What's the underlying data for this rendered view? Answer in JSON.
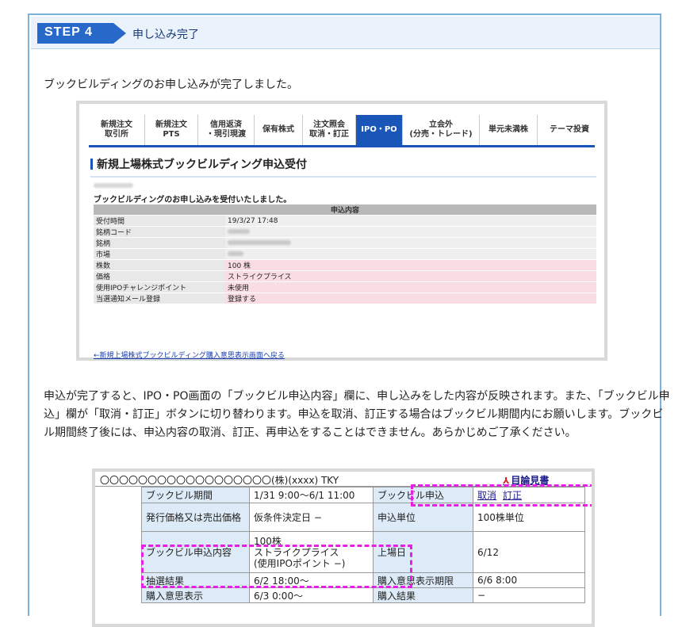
{
  "step": {
    "badge": "STEP 4",
    "title": "申し込み完了"
  },
  "intro": "ブックビルディングのお申し込みが完了しました。",
  "screenshot1": {
    "tabs": [
      {
        "l1": "新規注文",
        "l2": "取引所"
      },
      {
        "l1": "新規注文",
        "l2": "PTS"
      },
      {
        "l1": "信用返済",
        "l2": "・現引現渡"
      },
      {
        "l1": "保有株式",
        "l2": ""
      },
      {
        "l1": "注文照会",
        "l2": "取消・訂正"
      },
      {
        "l1": "IPO・PO",
        "l2": ""
      },
      {
        "l1": "立会外",
        "l2": "(分売・トレード)"
      },
      {
        "l1": "単元未満株",
        "l2": ""
      },
      {
        "l1": "テーマ投資",
        "l2": ""
      }
    ],
    "title": "新規上場株式ブックビルディング申込受付",
    "message": "ブックビルディングのお申し込みを受付いたしました。",
    "table_header": "申込内容",
    "rows": [
      {
        "label": "受付時間",
        "value": "19/3/27 17:48"
      },
      {
        "label": "銘柄コード",
        "value": ""
      },
      {
        "label": "銘柄",
        "value": ""
      },
      {
        "label": "市場",
        "value": ""
      },
      {
        "label": "株数",
        "value": "100 株"
      },
      {
        "label": "価格",
        "value": "ストライクプライス"
      },
      {
        "label": "使用IPOチャレンジポイント",
        "value": "未使用"
      },
      {
        "label": "当選通知メール登録",
        "value": "登録する"
      }
    ],
    "back_link": "←新規上場株式ブックビルディング購入意思表示画面へ戻る"
  },
  "paragraph": "申込が完了すると、IPO・PO画面の「ブックビル申込内容」欄に、申し込みをした内容が反映されます。また、「ブックビル申込」欄が「取消・訂正」ボタンに切り替わります。申込を取消、訂正する場合はブックビル期間内にお願いします。ブックビル期間終了後には、申込内容の取消、訂正、再申込をすることはできません。あらかじめご了承ください。",
  "screenshot2": {
    "company": "〇〇〇〇〇〇〇〇〇〇〇〇〇〇〇〇〇〇(株)(xxxx) TKY",
    "prospectus": "目論見書",
    "bookbuild_period_label": "ブックビル期間",
    "bookbuild_period_value": "1/31 9:00〜6/1 11:00",
    "bookbuild_apply_label": "ブックビル申込",
    "cancel": "取消",
    "correct": "訂正",
    "price_label": "発行価格又は売出価格",
    "price_value": "仮条件決定日 −",
    "unit_label": "申込単位",
    "unit_value": "100株単位",
    "content_label": "ブックビル申込内容",
    "content_l1": "100株",
    "content_l2": "ストライクプライス",
    "content_l3": "(使用IPOポイント −)",
    "listing_label": "上場日",
    "listing_value": "6/12",
    "lottery_label": "抽選結果",
    "lottery_value": "6/2 18:00〜",
    "deadline_label": "購入意思表示期限",
    "deadline_value": "6/6 8:00",
    "intent_label": "購入意思表示",
    "intent_value": "6/3 0:00〜",
    "result_label": "購入結果",
    "result_value": "−"
  }
}
